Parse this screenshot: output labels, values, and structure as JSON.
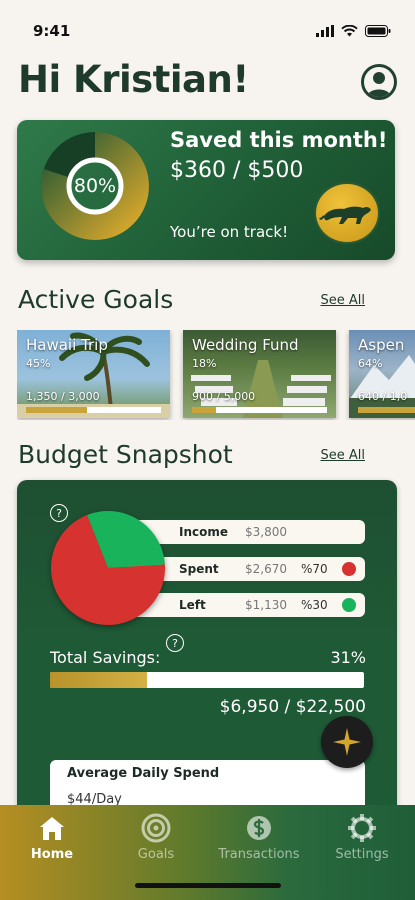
{
  "status_bar": {
    "time": "9:41"
  },
  "header": {
    "greeting": "Hi Kristian!"
  },
  "hero": {
    "progress_percent": 80,
    "progress_label": "80%",
    "title": "Saved this month!",
    "amount": "$360 / $500",
    "status": "You’re on track!"
  },
  "active_goals": {
    "title": "Active Goals",
    "see_all": "See All",
    "goals": [
      {
        "name": "Hawaii Trip",
        "percent": "45%",
        "amount": "1,350 / 3,000",
        "progress": 0.45
      },
      {
        "name": "Wedding Fund",
        "percent": "18%",
        "amount": "900 / 5,000",
        "progress": 0.18
      },
      {
        "name": "Aspen",
        "percent": "64%",
        "amount": "640 / 1,0",
        "progress": 0.64
      }
    ]
  },
  "budget": {
    "title": "Budget Snapshot",
    "see_all": "See All",
    "rows": [
      {
        "label": "Income",
        "value": "$3,800",
        "pct": ""
      },
      {
        "label": "Spent",
        "value": "$2,670",
        "pct": "%70"
      },
      {
        "label": "Left",
        "value": "$1,130",
        "pct": "%30"
      }
    ],
    "help_mark": "?",
    "savings_label": "Total Savings:",
    "savings_pct": "31%",
    "savings_progress": 0.31,
    "savings_amount": "$6,950 / $22,500",
    "daily_title": "Average Daily Spend",
    "daily_value": "$44/Day"
  },
  "colors": {
    "spent": "#d6322f",
    "left": "#19b35c",
    "gold": "#c9a43a",
    "brand_green": "#1f5a36"
  },
  "tabs": [
    {
      "label": "Home",
      "icon": "home-icon",
      "active": true
    },
    {
      "label": "Goals",
      "icon": "target-icon",
      "active": false
    },
    {
      "label": "Transactions",
      "icon": "money-icon",
      "active": false
    },
    {
      "label": "Settings",
      "icon": "gear-icon",
      "active": false
    }
  ]
}
